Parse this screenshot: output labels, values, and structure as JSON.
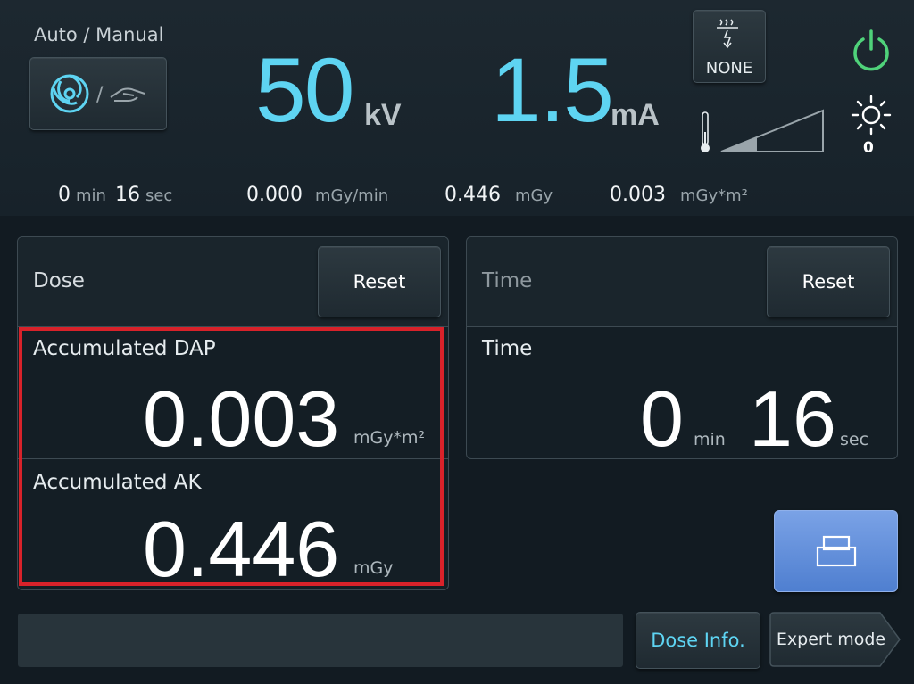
{
  "header": {
    "auto_manual_label": "Auto / Manual",
    "kv_value": "50",
    "kv_unit": "kV",
    "ma_value": "1.5",
    "ma_unit": "mA",
    "filter_label": "NONE",
    "brightness_value": "0"
  },
  "stats": {
    "time_min": "0",
    "time_min_unit": "min",
    "time_sec": "16",
    "time_sec_unit": "sec",
    "dose_rate": "0.000",
    "dose_rate_unit": "mGy/min",
    "dose": "0.446",
    "dose_unit": "mGy",
    "dap": "0.003",
    "dap_unit": "mGy*m²"
  },
  "dose_panel": {
    "title": "Dose",
    "reset_label": "Reset",
    "dap_title": "Accumulated DAP",
    "dap_value": "0.003",
    "dap_unit": "mGy*m²",
    "ak_title": "Accumulated AK",
    "ak_value": "0.446",
    "ak_unit": "mGy"
  },
  "time_panel": {
    "title": "Time",
    "reset_label": "Reset",
    "sub_title": "Time",
    "min_value": "0",
    "min_unit": "min",
    "sec_value": "16",
    "sec_unit": "sec"
  },
  "footer": {
    "dose_info_label": "Dose Info.",
    "expert_mode_label": "Expert mode"
  },
  "icons": {
    "auto_mode": "auto-mode-icon",
    "manual_mode": "hand-icon",
    "filter": "heat-filter-icon",
    "power": "power-icon",
    "thermometer": "thermometer-icon",
    "level": "level-ramp-icon",
    "brightness": "sun-icon",
    "print": "print-icon"
  },
  "colors": {
    "accent": "#5ed4f2",
    "power": "#4fd27a",
    "highlight": "#d8222a",
    "print_button": "#5f8fdc"
  }
}
